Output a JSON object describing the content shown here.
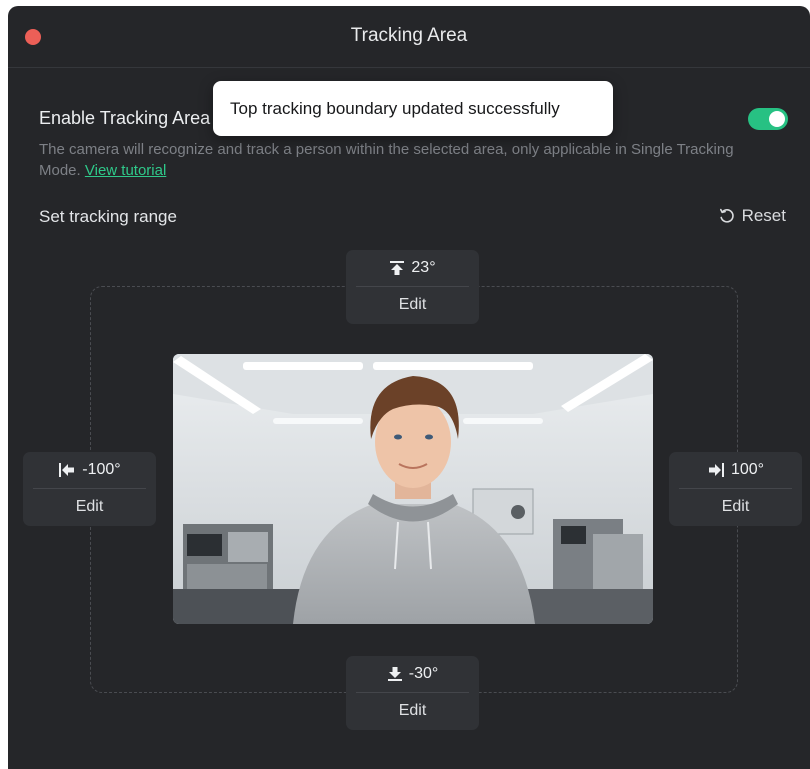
{
  "window": {
    "title": "Tracking Area"
  },
  "toast": {
    "message": "Top tracking boundary updated successfully"
  },
  "tracking": {
    "enable_label": "Enable Tracking Area",
    "enabled": true,
    "description": "The camera will recognize and track a person within the selected area, only applicable in Single Tracking Mode.",
    "tutorial_link": "View tutorial"
  },
  "range": {
    "label": "Set tracking range",
    "reset_label": "Reset",
    "top": {
      "value": "23°",
      "edit_label": "Edit",
      "icon": "arrow-up-bar-icon"
    },
    "left": {
      "value": "-100°",
      "edit_label": "Edit",
      "icon": "arrow-left-bar-icon"
    },
    "right": {
      "value": "100°",
      "edit_label": "Edit",
      "icon": "arrow-right-bar-icon"
    },
    "bottom": {
      "value": "-30°",
      "edit_label": "Edit",
      "icon": "arrow-down-bar-icon"
    }
  },
  "colors": {
    "background": "#252629",
    "card": "#303236",
    "accent": "#27c183",
    "close": "#ec5f57"
  }
}
